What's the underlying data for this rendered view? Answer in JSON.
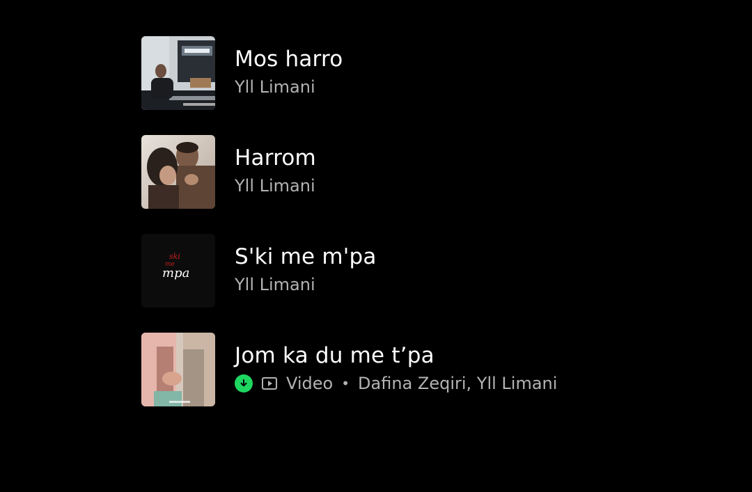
{
  "tracks": [
    {
      "title": "Mos harro",
      "artist": "Yll Limani",
      "cover_icon": "album-cover-mos-harro"
    },
    {
      "title": "Harrom",
      "artist": "Yll Limani",
      "cover_icon": "album-cover-harrom"
    },
    {
      "title": "S'ki me m'pa",
      "artist": "Yll Limani",
      "cover_icon": "album-cover-ski-me-mpa",
      "cover_text_top": "ski\nme",
      "cover_text_main": "mpa"
    },
    {
      "title": "Jom ka du me t’pa",
      "type_label": "Video",
      "separator": "•",
      "artist": "Dafina Zeqiri, Yll Limani",
      "downloaded": true,
      "cover_icon": "album-cover-jom-ka-du-me-tpa"
    }
  ],
  "colors": {
    "background": "#000000",
    "title": "#ffffff",
    "subtitle": "#b3b3b3",
    "download_green": "#1ed760"
  },
  "icons": {
    "download": "download-arrow-icon",
    "video": "video-play-icon"
  }
}
